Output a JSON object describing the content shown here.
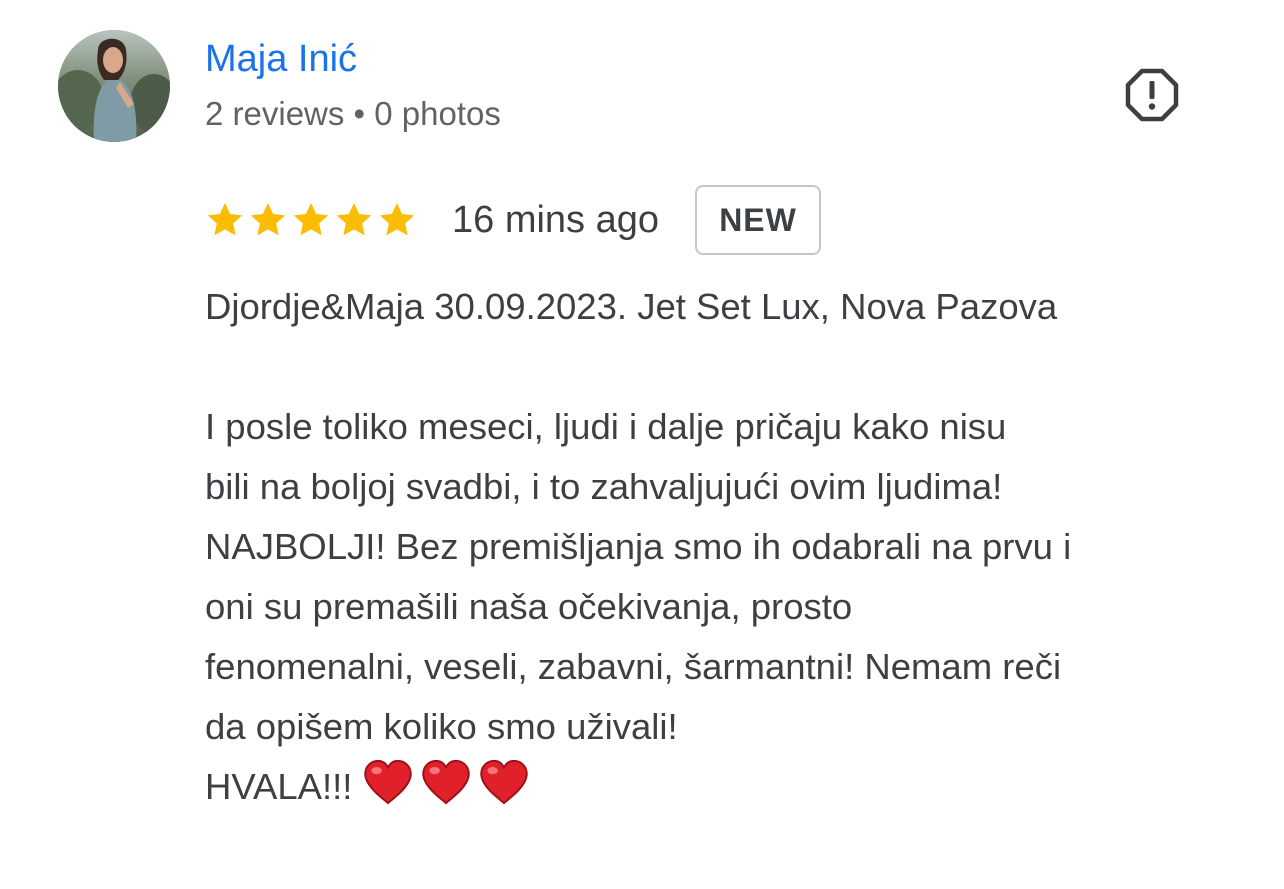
{
  "reviewer": {
    "name": "Maja Inić",
    "meta": "2 reviews • 0 photos"
  },
  "review": {
    "rating": 5,
    "rating_max": 5,
    "time_ago": "16 mins ago",
    "badge": "NEW",
    "paragraph1": "Djordje&Maja 30.09.2023. Jet Set Lux, Nova Pazova",
    "paragraph2": "I posle toliko meseci, ljudi i dalje pričaju kako nisu\nbili na boljoj svadbi, i to zahvaljujući ovim ljudima!\nNAJBOLJI! Bez premišljanja smo ih odabrali na prvu i\noni su premašili naša očekivanja, prosto\nfenomenalni, veseli, zabavni, šarmantni! Nemam reči\nda opišem koliko smo uživali!",
    "closing": "HVALA!!!",
    "heart_count": 3
  },
  "colors": {
    "name_link": "#1a73e8",
    "text": "#3c4043",
    "meta": "#5f6368",
    "star": "#fbbc04",
    "heart": "#e0202b",
    "badge_border": "#c4c7c5"
  },
  "icons": {
    "report": "report-flag-octagon-icon",
    "star": "star-icon",
    "heart": "red-heart-emoji-icon"
  }
}
